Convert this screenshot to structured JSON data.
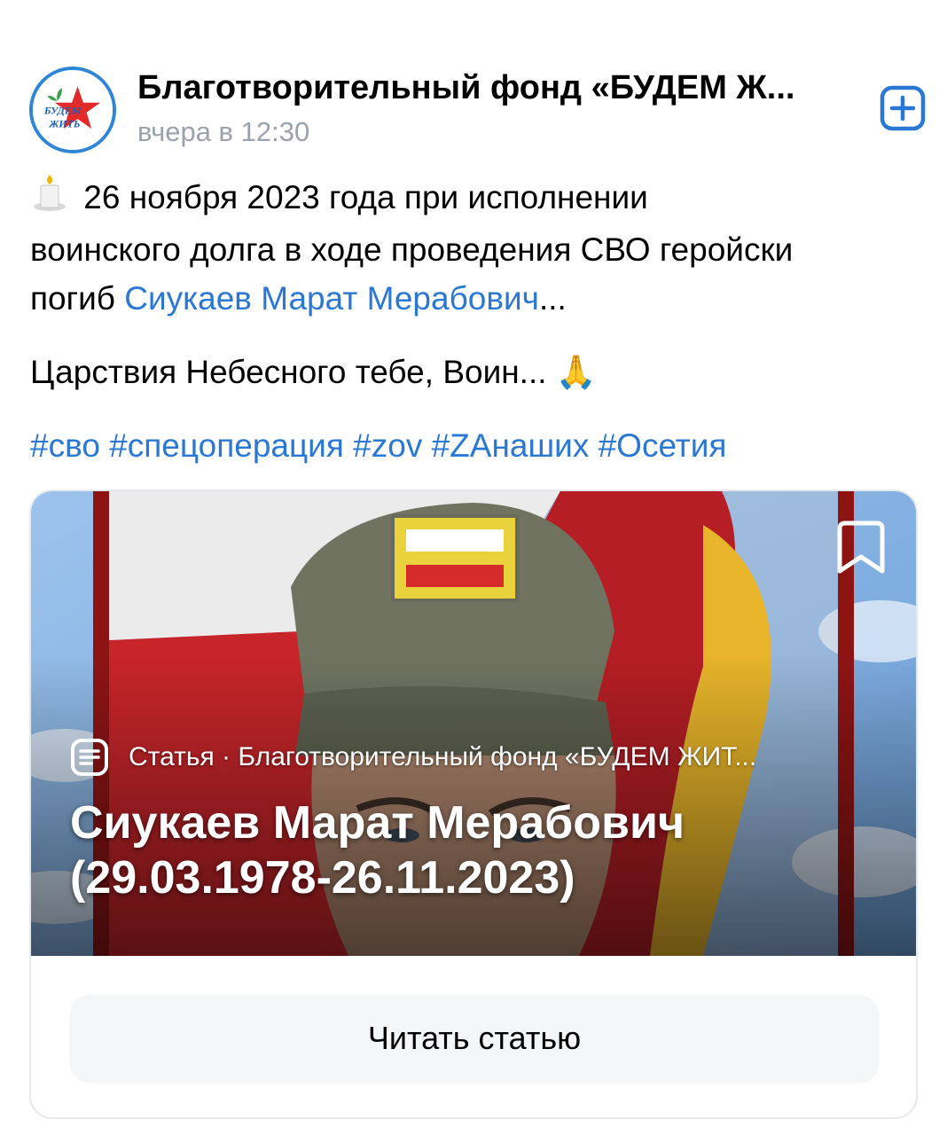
{
  "post": {
    "author": "Благотворительный фонд «БУДЕМ Ж...",
    "timestamp": "вчера в 12:30",
    "avatar_text": [
      "БУДЕМ",
      "ЖИТЬ"
    ],
    "line1_text": "26 ноября 2023 года при исполнении",
    "line2_text": "воинского долга в ходе проведения СВО геройски",
    "line3_prefix": "погиб ",
    "line3_link": "Сиукаев Марат Мерабович",
    "line3_suffix": "...",
    "line4_text": "Царствия Небесного тебе, Воин... ",
    "pray_emoji": "🙏",
    "hashtags": "#сво #спецоперация #zov #ZАнаших #Осетия"
  },
  "article": {
    "meta": "Статья · Благотворительный фонд «БУДЕМ ЖИТ...",
    "title_line1": "Сиукаев Марат Мерабович",
    "title_line2": "(29.03.1978-26.11.2023)",
    "read_button": "Читать статью"
  },
  "colors": {
    "accent": "#2a78d4",
    "timestamp": "#99a2ad"
  },
  "icons": [
    "plus-square-icon",
    "candle-icon",
    "bookmark-icon",
    "article-icon",
    "pray-icon"
  ]
}
